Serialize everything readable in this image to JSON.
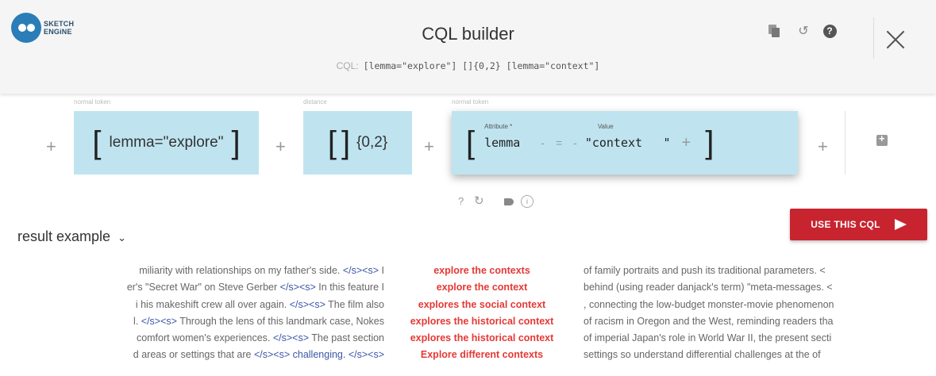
{
  "header": {
    "logo_line1": "SKETCH",
    "logo_line2": "ENGiNE",
    "title": "CQL builder",
    "cql_prefix": "CQL:",
    "cql_query": "[lemma=\"explore\"] []{0,2} [lemma=\"context\"]"
  },
  "builder": {
    "token_label_normal": "normal token",
    "token_label_distance": "distance",
    "token1_text": "lemma=\"explore\"",
    "token2_text": "{0,2}",
    "token3_attribute_label": "Attribute *",
    "token3_attribute_value": "lemma",
    "token3_operator": "=",
    "token3_value_label": "Value",
    "token3_value": "\"context",
    "token3_value_suffix": "\"",
    "plus": "+",
    "question_mark": "?",
    "info": "i"
  },
  "results": {
    "title": "result example",
    "use_button_label": "USE THIS CQL",
    "rows": [
      {
        "left_a": "miliarity with relationships on my father's side. ",
        "left_tag": "</s><s>",
        "left_b": " I",
        "kw": "explore the contexts",
        "right": "of family portraits and push its traditional parameters. <"
      },
      {
        "left_a": "er's \"Secret War\" on Steve Gerber ",
        "left_tag": "</s><s>",
        "left_b": " In this feature I",
        "kw": "explore the context",
        "right": "behind (using reader danjack's term) \"meta-messages. <"
      },
      {
        "left_a": "i his makeshift crew all over again. ",
        "left_tag": "</s><s>",
        "left_b": " The film also",
        "kw": "explores the social context",
        "right": ", connecting the low-budget monster-movie phenomenon"
      },
      {
        "left_a": "l. ",
        "left_tag": "</s><s>",
        "left_b": " Through the lens of this landmark case, Nokes",
        "kw": "explores the historical context",
        "right": "of racism in Oregon and the West, reminding readers tha"
      },
      {
        "left_a": "comfort women's experiences. ",
        "left_tag": "</s><s>",
        "left_b": " The past section",
        "kw": "explores the historical context",
        "right": "of imperial Japan's role in World War II, the present secti"
      },
      {
        "left_a": "d areas or settings that are ",
        "left_tag": "</s><s>",
        "left_b": " challenging. </s><s>",
        "kw": "Explore different contexts",
        "right": "settings so understand differential challenges at the of"
      }
    ]
  },
  "colors": {
    "accent_red": "#c8242f",
    "keyword_red": "#e53935",
    "token_bg": "#bfe4f0",
    "tag_blue": "#3b57a8"
  },
  "icons": [
    "copy-icon",
    "history-icon",
    "help-icon",
    "close-icon",
    "add-token-icon",
    "refresh-icon",
    "tag-icon",
    "info-icon",
    "chevron-down-icon",
    "send-icon"
  ]
}
